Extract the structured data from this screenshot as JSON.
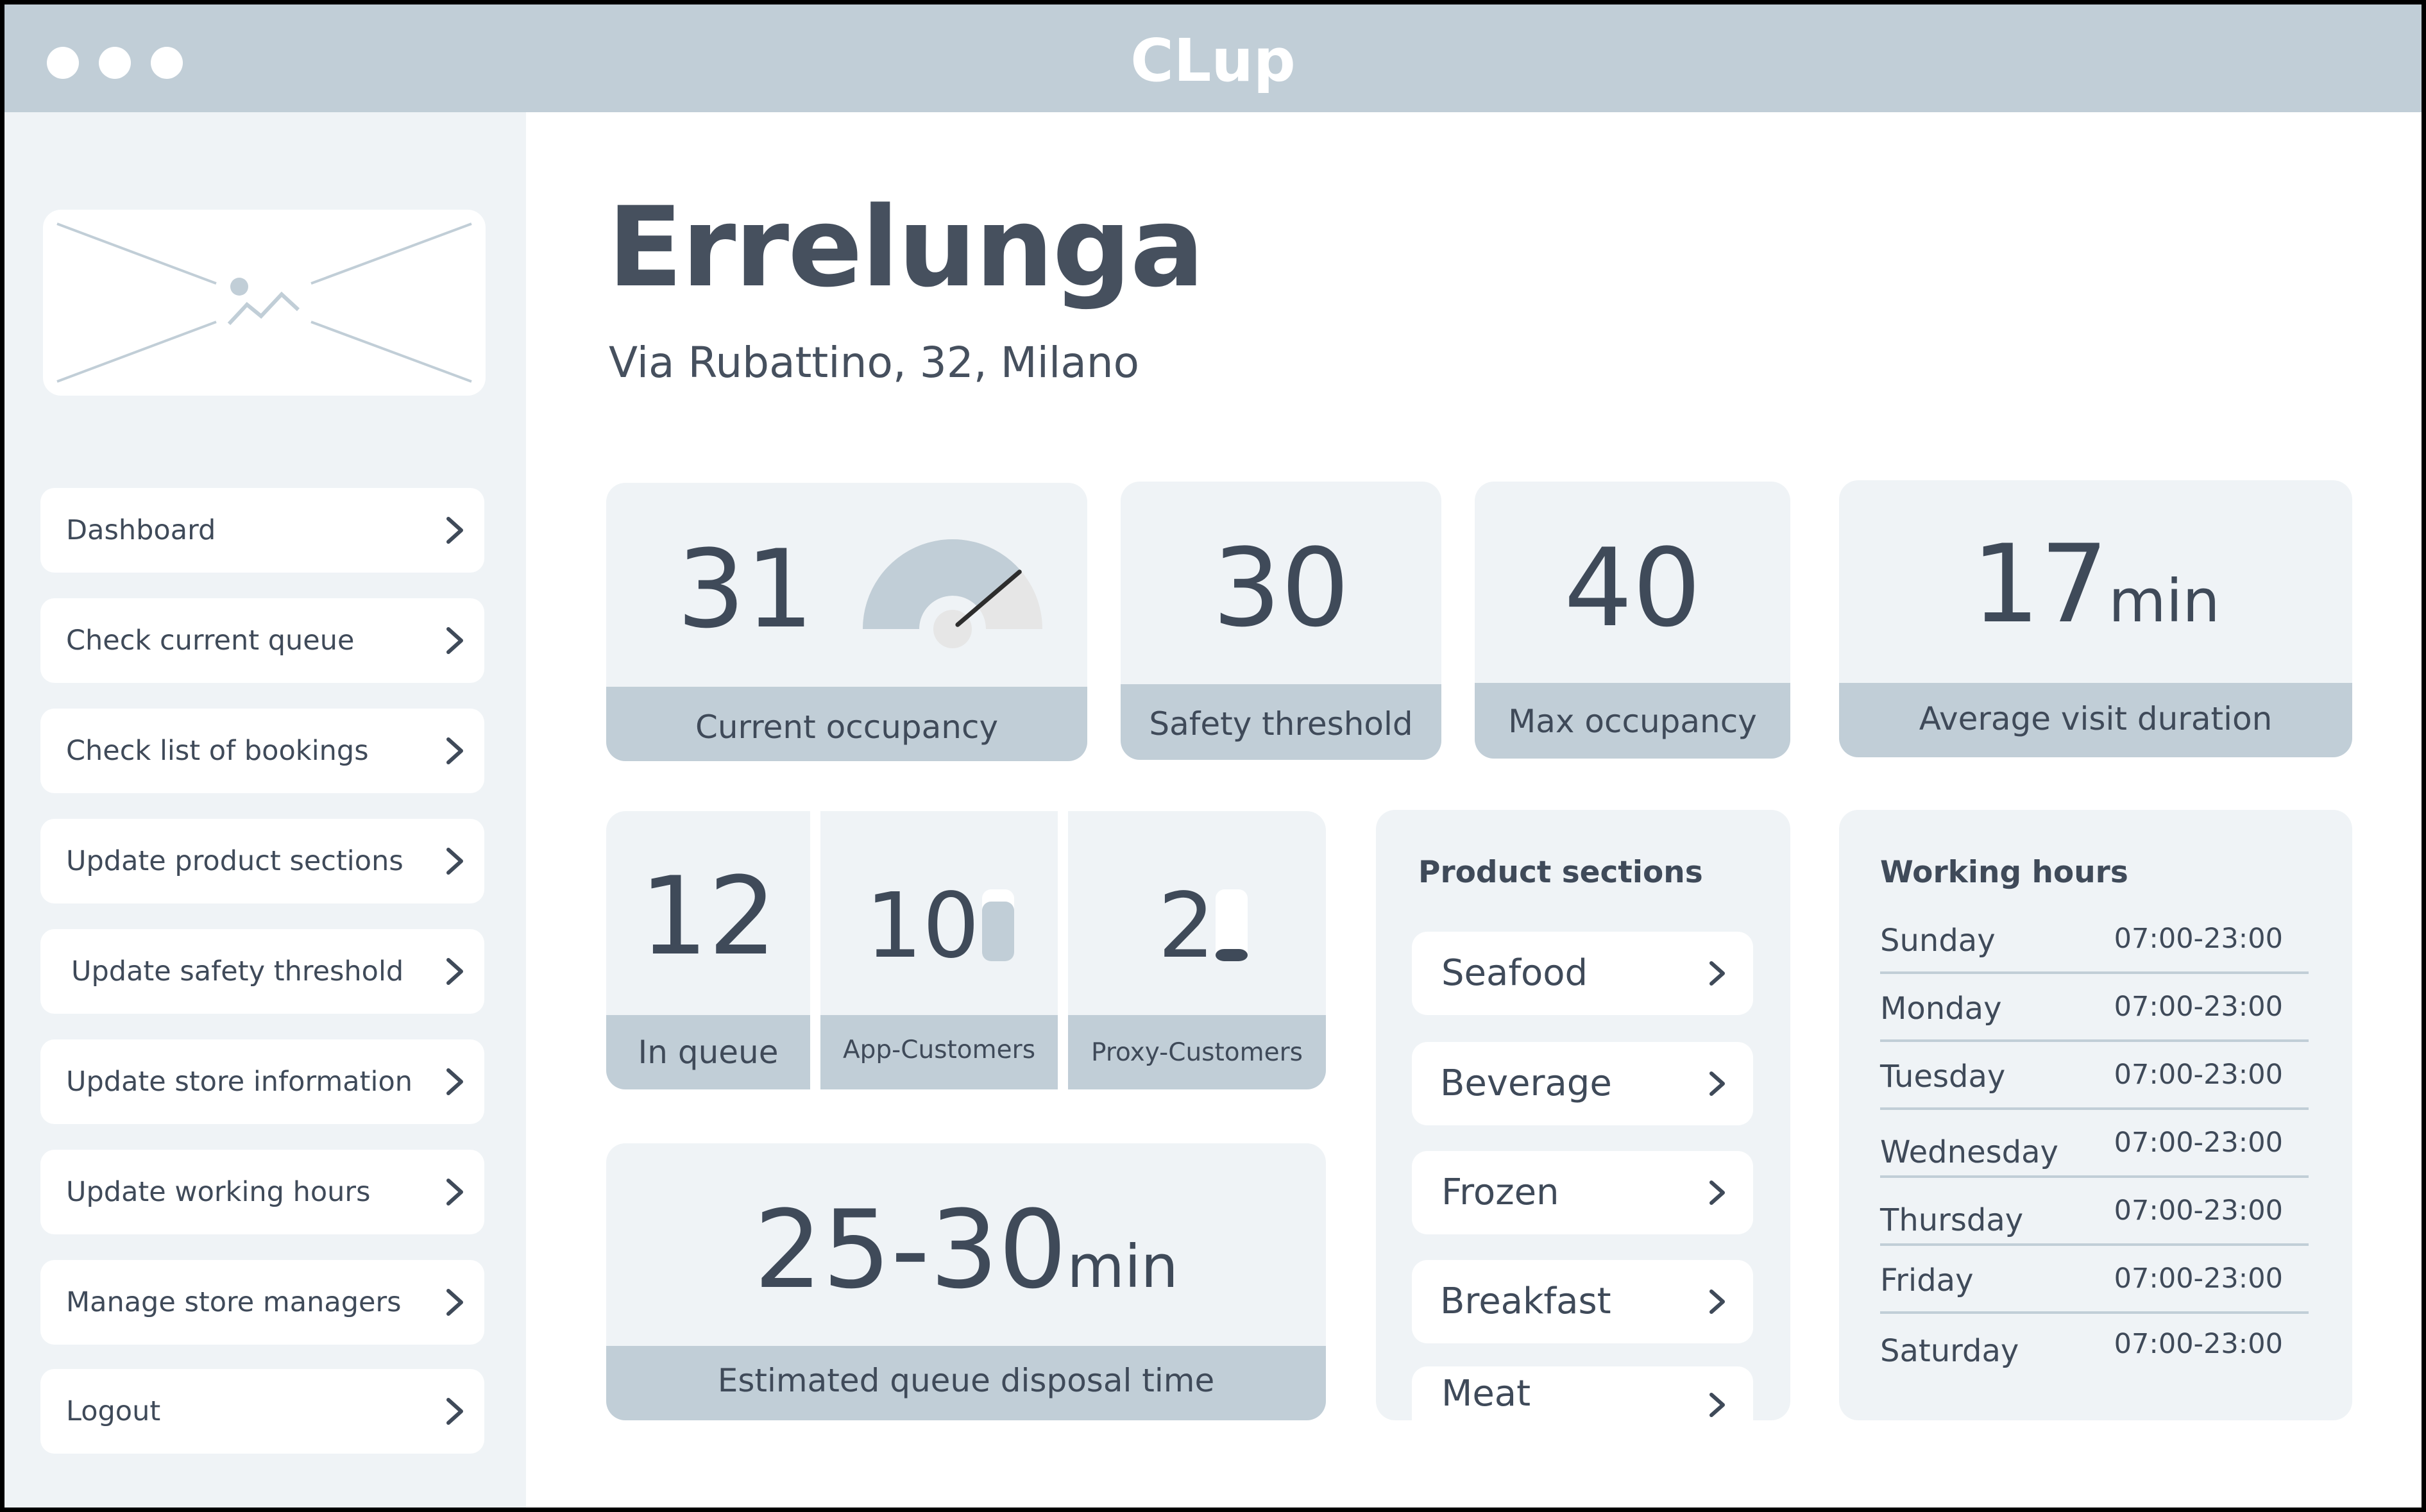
{
  "window": {
    "title": "CLup"
  },
  "sidebar": {
    "items": [
      {
        "label": "Dashboard"
      },
      {
        "label": "Check current queue"
      },
      {
        "label": "Check list of bookings"
      },
      {
        "label": "Update product sections"
      },
      {
        "label": "Update safety threshold"
      },
      {
        "label": "Update store information"
      },
      {
        "label": "Update working hours"
      },
      {
        "label": "Manage store managers"
      },
      {
        "label": "Logout"
      }
    ]
  },
  "store": {
    "name": "Errelunga",
    "address": "Via Rubattino, 32, Milano"
  },
  "stats": {
    "current_occupancy": {
      "value": "31",
      "label": "Current occupancy"
    },
    "safety_threshold": {
      "value": "30",
      "label": "Safety threshold"
    },
    "max_occupancy": {
      "value": "40",
      "label": "Max occupancy"
    },
    "avg_visit": {
      "value": "17",
      "unit": "min",
      "label": "Average visit duration"
    },
    "in_queue": {
      "value": "12",
      "label": "In queue"
    },
    "app_customers": {
      "value": "10",
      "label": "App-Customers",
      "fill_fraction": 0.83
    },
    "proxy_customers": {
      "value": "2",
      "label": "Proxy-Customers",
      "fill_fraction": 0.17
    },
    "disposal_time": {
      "value": "25-30",
      "unit": "min",
      "label": "Estimated queue disposal time"
    }
  },
  "gauge": {
    "value": 31,
    "max": 40
  },
  "product_sections": {
    "title": "Product sections",
    "items": [
      {
        "label": "Seafood"
      },
      {
        "label": "Beverage"
      },
      {
        "label": "Frozen"
      },
      {
        "label": "Breakfast"
      },
      {
        "label": "Meat"
      }
    ]
  },
  "working_hours": {
    "title": "Working hours",
    "rows": [
      {
        "day": "Sunday",
        "hours": "07:00-23:00"
      },
      {
        "day": "Monday",
        "hours": "07:00-23:00"
      },
      {
        "day": "Tuesday",
        "hours": "07:00-23:00"
      },
      {
        "day": "Wednesday",
        "hours": "07:00-23:00"
      },
      {
        "day": "Thursday",
        "hours": "07:00-23:00"
      },
      {
        "day": "Friday",
        "hours": "07:00-23:00"
      },
      {
        "day": "Saturday",
        "hours": "07:00-23:00"
      }
    ]
  },
  "icons": {
    "chevron": "chevron-right-icon",
    "logo_placeholder": "image-placeholder-icon"
  },
  "colors": {
    "accent_band": "#c1ced7",
    "card_bg": "#eff3f6",
    "text": "#3f4a59"
  }
}
